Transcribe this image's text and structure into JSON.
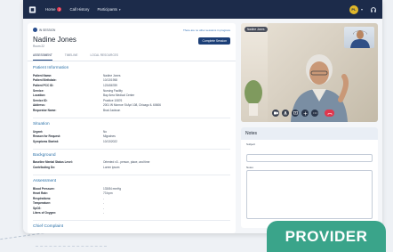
{
  "topbar": {
    "nav": [
      {
        "label": "Home",
        "badge": "2"
      },
      {
        "label": "Call History"
      },
      {
        "label": "Participants",
        "has_chevron": true
      }
    ],
    "avatar_initials": "PL"
  },
  "patient": {
    "status": "IN SESSION",
    "status_note": "There are no other sessions in progress",
    "name": "Nadine Jones",
    "id": "Room 22",
    "complete_label": "Complete Session"
  },
  "tabs": [
    "ASSESSMENT",
    "TIMELINE",
    "LOCAL RESOURCES"
  ],
  "sections": {
    "info_title": "Patient Information",
    "info_rows": [
      {
        "k": "Patient Name:",
        "v": "Nadine Jones"
      },
      {
        "k": "Patient Birthdate:",
        "v": "10/13/1958"
      },
      {
        "k": "Patient PCC ID:",
        "v": "123456789"
      },
      {
        "k": "Service:",
        "v": "Nursing Facility"
      },
      {
        "k": "Location:",
        "v": "Bay Area Medical Center"
      },
      {
        "k": "Service ID:",
        "v": "Practice 10876"
      },
      {
        "k": "Address:",
        "v": "2001 W Monroe St Apt 108, Chicago IL 60606"
      },
      {
        "k": "Requestor Name:",
        "v": "Brad Jackson"
      }
    ],
    "situation_title": "Situation",
    "situation_rows": [
      {
        "k": "Urgent:",
        "v": "No"
      },
      {
        "k": "Reason for Request:",
        "v": "Migraines"
      },
      {
        "k": "Symptoms Started:",
        "v": "10/13/2022"
      }
    ],
    "background_title": "Background",
    "background_rows": [
      {
        "k": "Baseline Mental Status Level:",
        "v": "Oriented x3 - person, place, and time"
      },
      {
        "k": "Contributing Dx:",
        "v": "Lorem ipsum"
      }
    ],
    "assessment_title": "Assessment",
    "assessment_rows": [
      {
        "k": "Blood Pressure:",
        "v": "133/84 mmHg"
      },
      {
        "k": "Heart Rate:",
        "v": "73 bpm"
      },
      {
        "k": "Respirations:",
        "v": "-"
      },
      {
        "k": "Temperature:",
        "v": "-"
      },
      {
        "k": "SpO2:",
        "v": "-"
      },
      {
        "k": "Liters of Oxygen:",
        "v": "-"
      }
    ],
    "complaint_title": "Chief Complaint"
  },
  "video": {
    "label": "Nadine Jones"
  },
  "notes": {
    "title": "Notes",
    "subject_label": "Subject",
    "notes_label": "Notes"
  },
  "banner": "PROVIDER",
  "colors": {
    "accent": "#1c3f77",
    "section": "#2a70a8",
    "end_call": "#e0374e",
    "banner": "#3aa48a"
  }
}
